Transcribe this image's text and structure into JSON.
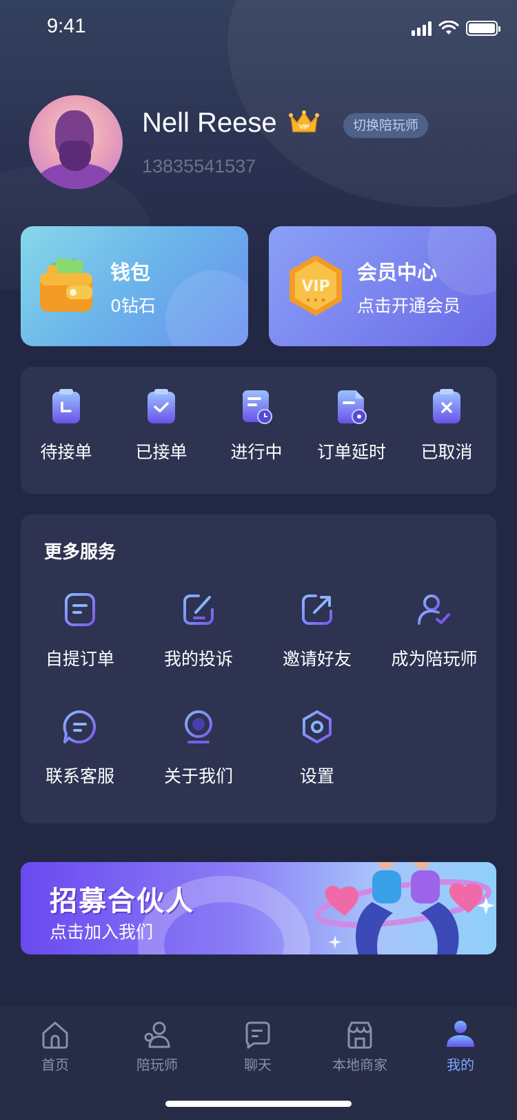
{
  "status_bar": {
    "time": "9:41"
  },
  "profile": {
    "name": "Nell Reese",
    "switch_label": "切换陪玩师",
    "phone": "13835541537",
    "badge": "VIP"
  },
  "cards": {
    "wallet": {
      "title": "钱包",
      "subtitle": "0钻石"
    },
    "vip": {
      "title": "会员中心",
      "subtitle": "点击开通会员",
      "badge": "VIP"
    }
  },
  "orders": [
    {
      "label": "待接单",
      "icon": "clipboard-clock-icon"
    },
    {
      "label": "已接单",
      "icon": "clipboard-check-icon"
    },
    {
      "label": "进行中",
      "icon": "document-progress-icon"
    },
    {
      "label": "订单延时",
      "icon": "document-timer-icon"
    },
    {
      "label": "已取消",
      "icon": "clipboard-cancel-icon"
    }
  ],
  "services": {
    "title": "更多服务",
    "items": [
      {
        "label": "自提订单",
        "icon": "order-list-icon"
      },
      {
        "label": "我的投诉",
        "icon": "edit-icon"
      },
      {
        "label": "邀请好友",
        "icon": "share-icon"
      },
      {
        "label": "成为陪玩师",
        "icon": "user-check-icon"
      },
      {
        "label": "联系客服",
        "icon": "chat-bubble-icon"
      },
      {
        "label": "关于我们",
        "icon": "info-circle-icon"
      },
      {
        "label": "设置",
        "icon": "hexagon-settings-icon"
      }
    ]
  },
  "banner": {
    "title": "招募合伙人",
    "subtitle": "点击加入我们"
  },
  "tabbar": {
    "active": "我的",
    "items": [
      {
        "label": "首页",
        "icon": "home-icon"
      },
      {
        "label": "陪玩师",
        "icon": "users-icon"
      },
      {
        "label": "聊天",
        "icon": "chat-icon"
      },
      {
        "label": "本地商家",
        "icon": "store-icon"
      },
      {
        "label": "我的",
        "icon": "profile-icon"
      }
    ]
  },
  "colors": {
    "background": "#222844",
    "panel": "#2d3350",
    "accent": "#7aa8ff",
    "icon_gradient_start": "#8ab4ff",
    "icon_gradient_end": "#7a5af0"
  }
}
